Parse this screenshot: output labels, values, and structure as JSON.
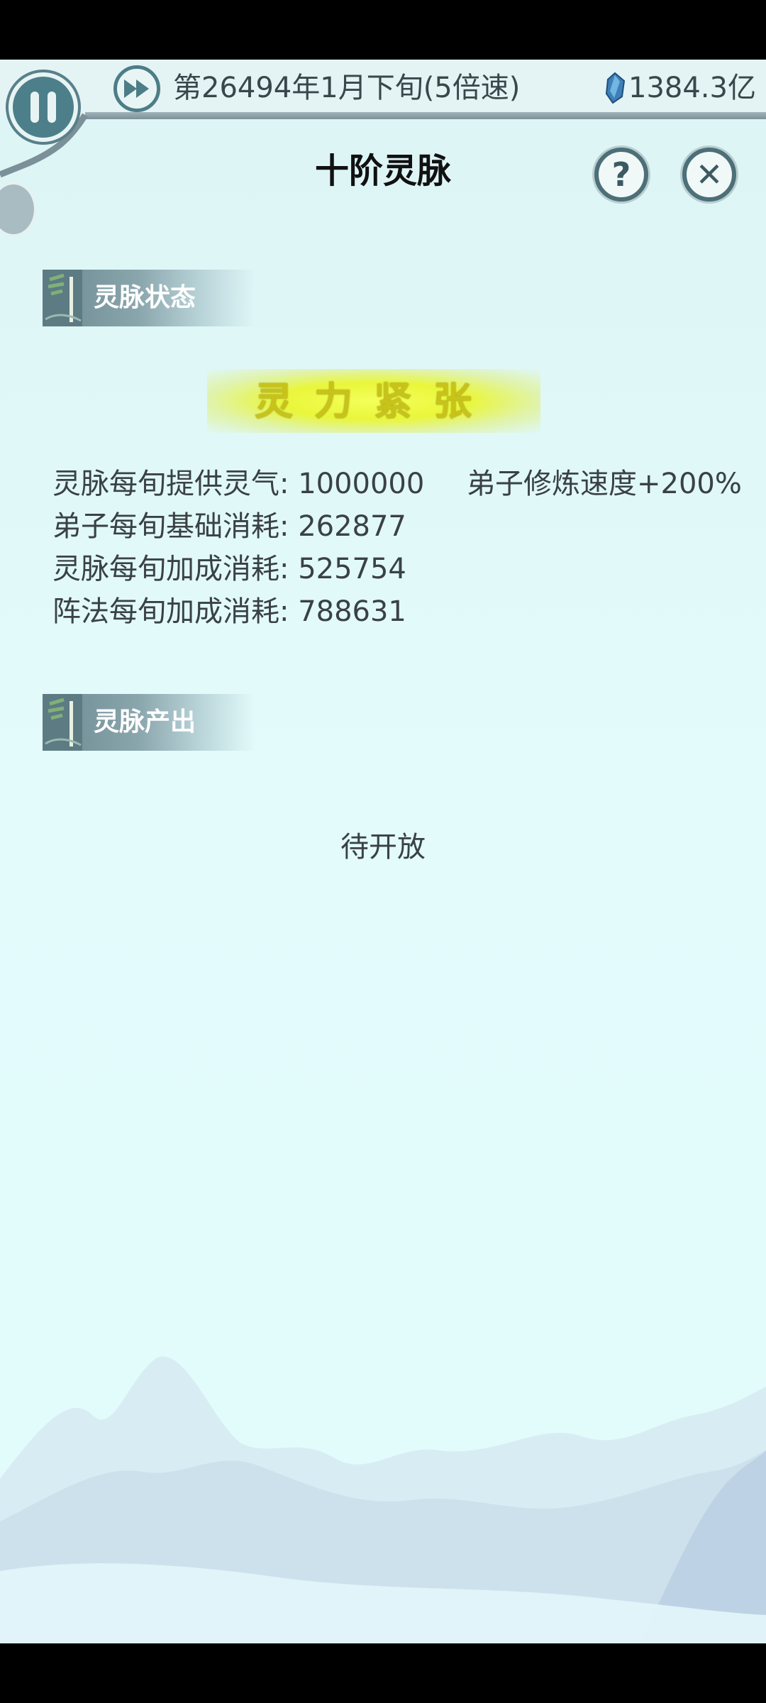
{
  "header": {
    "date_text": "第26494年1月下旬(5倍速)",
    "spirit_stones": "1384.3亿"
  },
  "page": {
    "title": "十阶灵脉"
  },
  "sections": {
    "status": {
      "title": "灵脉状态",
      "state": "灵力紧张",
      "lines": [
        "灵脉每旬提供灵气: 1000000",
        "弟子每旬基础消耗: 262877",
        "灵脉每旬加成消耗: 525754",
        "阵法每旬加成消耗: 788631"
      ],
      "bonus": "弟子修炼速度+200%"
    },
    "output": {
      "title": "灵脉产出",
      "content": "待开放"
    }
  },
  "icons": {
    "pause": "pause-icon",
    "fast_forward": "fast-forward-icon",
    "spirit_stone": "spirit-stone-icon",
    "help": "question-icon",
    "close": "close-icon"
  },
  "colors": {
    "background": "#e2fcfd",
    "accent": "#4c7f8a",
    "state_glow": "#f4ff5a"
  }
}
